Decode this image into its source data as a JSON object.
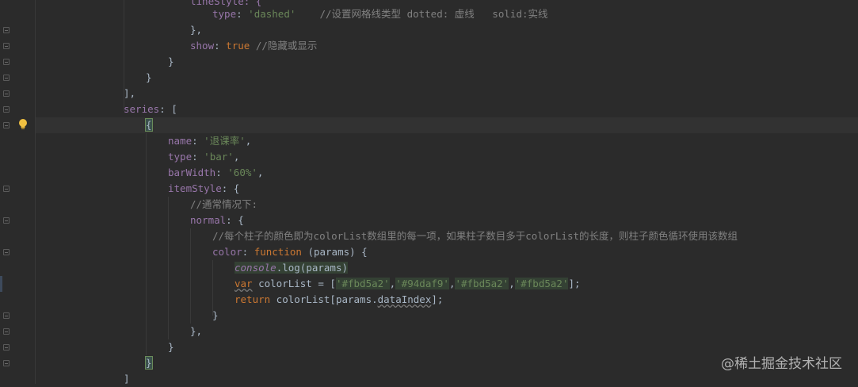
{
  "code": {
    "l0a": "lineStyle: {",
    "l1_key": "type",
    "l1_val": "'dashed'",
    "l1_cm": "//设置网格线类型 dotted: 虚线   solid:实线",
    "l2": "},",
    "l3_key": "show",
    "l3_val": "true",
    "l3_cm": "//隐藏或显示",
    "l4": "}",
    "l5": "}",
    "l6": "],",
    "l7_key": "series",
    "l7_rest": ": [",
    "l8": "{",
    "l9_key": "name",
    "l9_val": "'退课率'",
    "l10_key": "type",
    "l10_val": "'bar'",
    "l11_key": "barWidth",
    "l11_val": "'60%'",
    "l12_key": "itemStyle",
    "l12_rest": ": {",
    "l13_cm": "//通常情况下:",
    "l14_key": "normal",
    "l14_rest": ": {",
    "l15_cm": "//每个柱子的颜色即为colorList数组里的每一项，如果柱子数目多于colorList的长度，则柱子颜色循环使用该数组",
    "l16_key": "color",
    "l16_fn": "function",
    "l16_rest": " (params) {",
    "l17_obj": "console",
    "l17_rest": ".log(params)",
    "l18_var": "var",
    "l18_name": " colorList = [",
    "l18_c1": "'#fbd5a2'",
    "l18_c2": "'#94daf9'",
    "l18_c3": "'#fbd5a2'",
    "l18_c4": "'#fbd5a2'",
    "l18_end": "];",
    "l19_kw": "return",
    "l19_rest": " colorList[params.",
    "l19_prop": "dataIndex",
    "l19_end": "];",
    "l20": "}",
    "l21": "},",
    "l22": "}",
    "l23": "}",
    "l24": "]"
  },
  "watermark": "@稀土掘金技术社区",
  "icons": {
    "bulb": "lightbulb-icon"
  }
}
